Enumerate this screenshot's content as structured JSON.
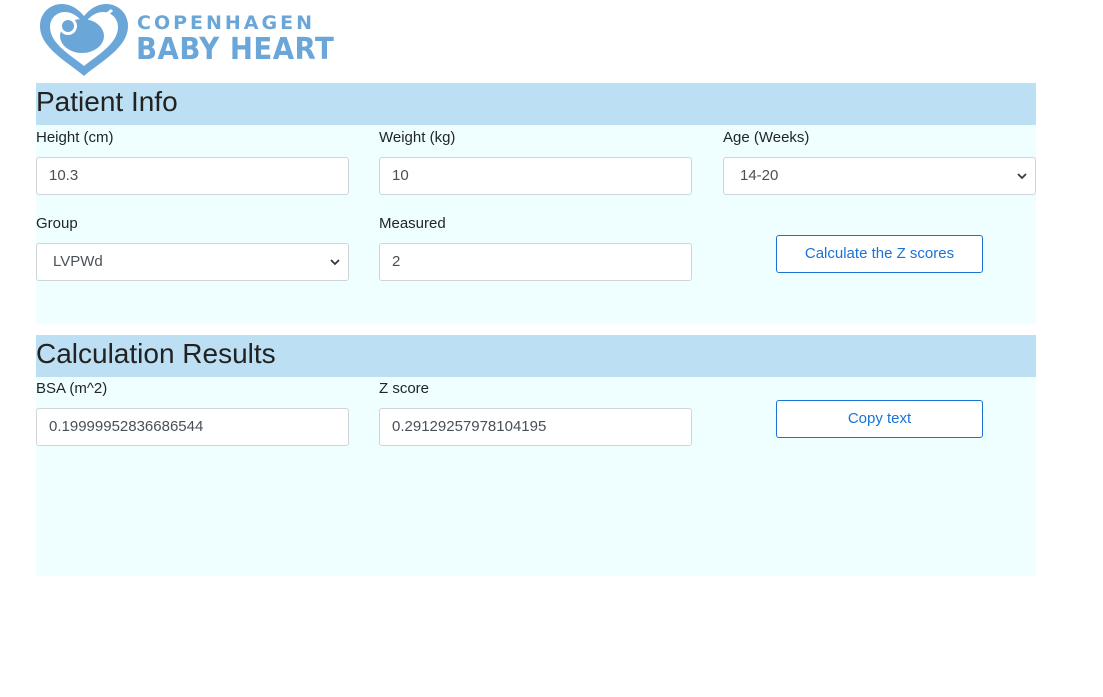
{
  "logo": {
    "line1": "COPENHAGEN",
    "line2": "BABY HEART",
    "icon": "heart-baby-icon",
    "color": "#6ba6d8"
  },
  "patient_info": {
    "title": "Patient Info",
    "height": {
      "label": "Height (cm)",
      "value": "10.3"
    },
    "weight": {
      "label": "Weight (kg)",
      "value": "10"
    },
    "age": {
      "label": "Age (Weeks)",
      "selected": "14-20"
    },
    "group": {
      "label": "Group",
      "selected": "LVPWd"
    },
    "measured": {
      "label": "Measured",
      "value": "2"
    },
    "calculate_button": "Calculate the Z scores"
  },
  "results": {
    "title": "Calculation Results",
    "bsa": {
      "label": "BSA (m^2)",
      "value": "0.19999952836686544"
    },
    "zscore": {
      "label": "Z score",
      "value": "0.29129257978104195"
    },
    "copy_button": "Copy text"
  },
  "colors": {
    "header_bg": "#bcdff3",
    "body_bg": "#efffff",
    "accent": "#1a73d4"
  }
}
